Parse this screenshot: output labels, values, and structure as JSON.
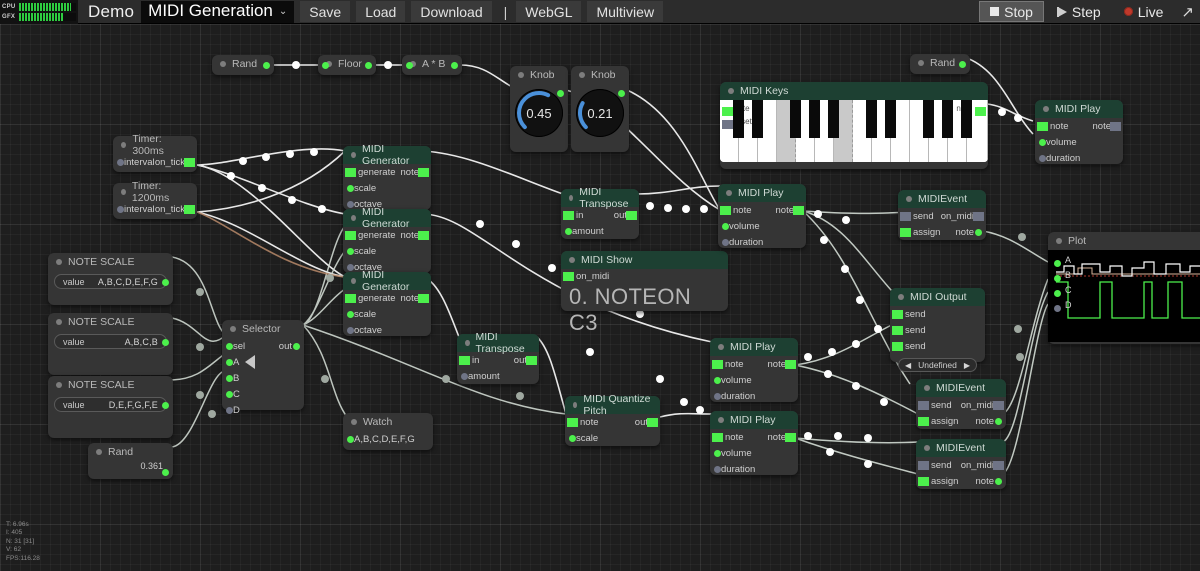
{
  "topbar": {
    "cpu_label": "CPU",
    "gfx_label": "GFX",
    "demo_label": "Demo",
    "project_name": "MIDI Generation",
    "project_chevron": "⌄",
    "buttons": [
      "Save",
      "Load",
      "Download"
    ],
    "separator": "|",
    "view_buttons": [
      "WebGL",
      "Multiview"
    ],
    "stop_label": "Stop",
    "step_label": "Step",
    "live_label": "Live",
    "expand_icon": "↗"
  },
  "stats": {
    "time": "T: 6.96s",
    "iterations": "I: 405",
    "nodes": "N: 31 [31]",
    "v": "V: 62",
    "fps": "FPS:116.28"
  },
  "colors": {
    "port_on": "#4cf04c",
    "port_off": "#6f7486",
    "node_title_green": "#1d4032",
    "knob_arc": "#4a90d9",
    "plot_trace_a": "#ffffff",
    "plot_trace_b": "#d8b49a",
    "plot_trace_c": "#4cf04c",
    "plot_trace_red": "#b03a2e"
  },
  "nodes": {
    "rand_top": {
      "title": "Rand"
    },
    "floor": {
      "title": "Floor"
    },
    "amulb": {
      "title": "A * B"
    },
    "rand_right": {
      "title": "Rand"
    },
    "knob1": {
      "title": "Knob",
      "value": "0.45",
      "pct": 45
    },
    "knob2": {
      "title": "Knob",
      "value": "0.21",
      "pct": 21
    },
    "timer300": {
      "title": "Timer: 300ms",
      "in": "interval",
      "out": "on_tick"
    },
    "timer1200": {
      "title": "Timer: 1200ms",
      "in": "interval",
      "out": "on_tick"
    },
    "note_scale_1": {
      "title": "NOTE SCALE",
      "key": "value",
      "value": "A,B,C,D,E,F,G"
    },
    "note_scale_2": {
      "title": "NOTE SCALE",
      "key": "value",
      "value": "A,B,C,B"
    },
    "note_scale_3": {
      "title": "NOTE SCALE",
      "key": "value",
      "value": "D,E,F,G,F,E"
    },
    "rand_bottom": {
      "title": "Rand",
      "value": "0.361"
    },
    "selector": {
      "title": "Selector",
      "sel": "sel",
      "out": "out",
      "opts": [
        "A",
        "B",
        "C",
        "D"
      ]
    },
    "midi_gen_1": {
      "title": "MIDI Generator",
      "in": "generate",
      "out": "note",
      "p2": "scale",
      "p3": "octave"
    },
    "midi_gen_2": {
      "title": "MIDI Generator",
      "in": "generate",
      "out": "note",
      "p2": "scale",
      "p3": "octave"
    },
    "midi_gen_3": {
      "title": "MIDI Generator",
      "in": "generate",
      "out": "note",
      "p2": "scale",
      "p3": "octave"
    },
    "watch": {
      "title": "Watch",
      "value": "A,B,C,D,E,F,G"
    },
    "midi_transpose_1": {
      "title": "MIDI Transpose",
      "in": "in",
      "out": "out",
      "p2": "amount"
    },
    "midi_transpose_2": {
      "title": "MIDI Transpose",
      "in": "in",
      "out": "out",
      "p2": "amount"
    },
    "midi_show": {
      "title": "MIDI Show",
      "in": "on_midi",
      "text": "0. NOTEON C3"
    },
    "midi_quantize": {
      "title": "MIDI Quantize Pitch",
      "in": "note",
      "out": "out",
      "p2": "scale"
    },
    "midi_keys": {
      "title": "MIDI Keys",
      "in": "note",
      "in2": "reset",
      "out": "note"
    },
    "midi_play_1": {
      "title": "MIDI Play",
      "in": "note",
      "out": "note",
      "p2": "volume",
      "p3": "duration"
    },
    "midi_play_2": {
      "title": "MIDI Play",
      "in": "note",
      "out": "note",
      "p2": "volume",
      "p3": "duration"
    },
    "midi_play_3": {
      "title": "MIDI Play",
      "in": "note",
      "out": "note",
      "p2": "volume",
      "p3": "duration"
    },
    "midi_play_4": {
      "title": "MIDI Play",
      "in": "note",
      "out": "note",
      "p2": "volume",
      "p3": "duration"
    },
    "midi_event_1": {
      "title": "MIDIEvent",
      "in": "send",
      "out": "on_midi",
      "p2": "assign",
      "out2": "note"
    },
    "midi_event_2": {
      "title": "MIDIEvent",
      "in": "send",
      "out": "on_midi",
      "p2": "assign",
      "out2": "note"
    },
    "midi_event_3": {
      "title": "MIDIEvent",
      "in": "send",
      "out": "on_midi",
      "p2": "assign",
      "out2": "note"
    },
    "midi_output": {
      "title": "MIDI Output",
      "s1": "send",
      "s2": "send",
      "s3": "send",
      "device": "Undefined",
      "left_arrow": "◀",
      "right_arrow": "▶"
    },
    "plot": {
      "title": "Plot",
      "ch": [
        "A",
        "B",
        "C",
        "D"
      ]
    }
  }
}
